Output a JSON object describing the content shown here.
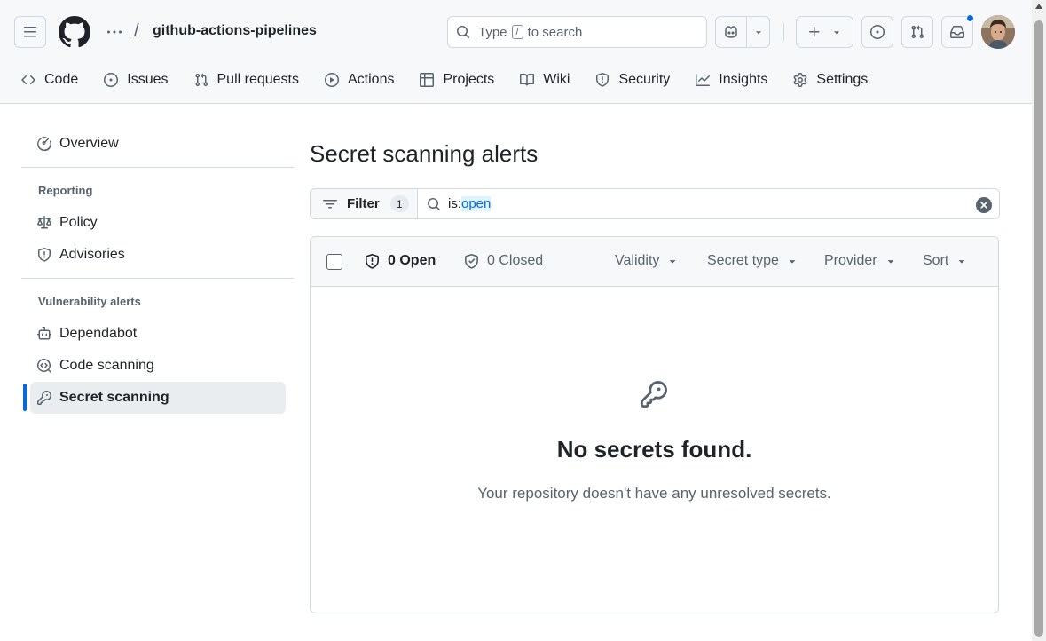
{
  "header": {
    "repo_name": "github-actions-pipelines",
    "separator": "/",
    "search": {
      "prefix": "Type",
      "kbd": "/",
      "suffix": "to search"
    },
    "icons": [
      "hamburger-icon",
      "github-logo",
      "kebab-icon",
      "search-icon",
      "copilot-icon",
      "plus-icon",
      "issue-opened-icon",
      "git-pull-request-icon",
      "inbox-icon"
    ],
    "notification_indicator": true
  },
  "repo_nav": {
    "items": [
      {
        "label": "Code",
        "icon": "code-icon"
      },
      {
        "label": "Issues",
        "icon": "issue-opened-icon"
      },
      {
        "label": "Pull requests",
        "icon": "git-pull-request-icon"
      },
      {
        "label": "Actions",
        "icon": "play-icon"
      },
      {
        "label": "Projects",
        "icon": "table-icon"
      },
      {
        "label": "Wiki",
        "icon": "book-icon"
      },
      {
        "label": "Security",
        "icon": "shield-icon"
      },
      {
        "label": "Insights",
        "icon": "graph-icon"
      },
      {
        "label": "Settings",
        "icon": "gear-icon"
      }
    ],
    "selected": "Security"
  },
  "sidebar": {
    "overview": "Overview",
    "reporting_heading": "Reporting",
    "reporting": [
      "Policy",
      "Advisories"
    ],
    "vuln_heading": "Vulnerability alerts",
    "vuln": [
      "Dependabot",
      "Code scanning",
      "Secret scanning"
    ],
    "active": "Secret scanning"
  },
  "main": {
    "title": "Secret scanning alerts",
    "filter": {
      "label": "Filter",
      "count": "1"
    },
    "query": {
      "key": "is:",
      "value": "open"
    },
    "toolbar": {
      "open": "0 Open",
      "closed": "0 Closed",
      "validity": "Validity",
      "secret_type": "Secret type",
      "provider": "Provider",
      "sort": "Sort"
    },
    "blankslate": {
      "icon": "key-icon",
      "title": "No secrets found.",
      "description": "Your repository doesn't have any unresolved secrets."
    }
  },
  "colors": {
    "accent": "#0969da",
    "header_bg": "#f6f8fa",
    "border": "#d1d9e0",
    "muted_text": "#59636e",
    "active_nav_bg": "#eaedf0"
  }
}
